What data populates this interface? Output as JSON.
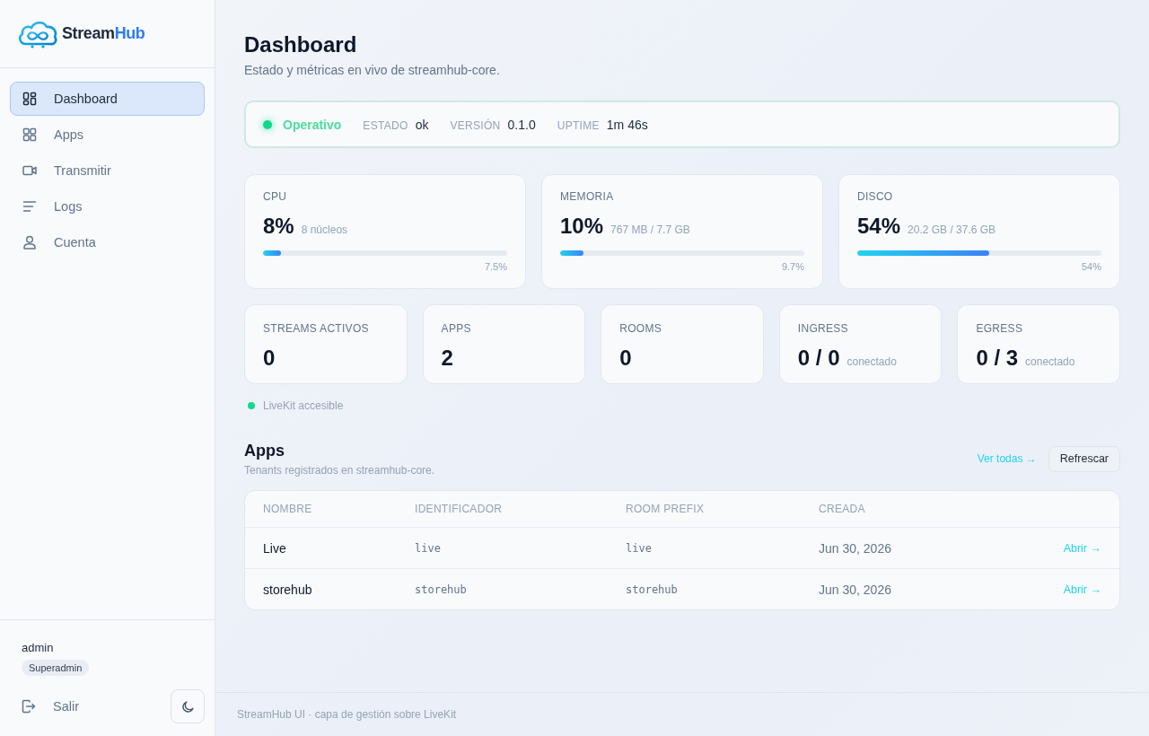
{
  "sidebar": {
    "brand": {
      "name": "Stream",
      "accent": "Hub"
    },
    "nav": [
      {
        "label": "Dashboard",
        "selected": true
      },
      {
        "label": "Apps",
        "selected": false
      },
      {
        "label": "Transmitir",
        "selected": false
      },
      {
        "label": "Logs",
        "selected": false
      },
      {
        "label": "Cuenta",
        "selected": false
      }
    ],
    "user": {
      "name": "admin",
      "role": "Superadmin"
    },
    "logout": "Salir"
  },
  "header": {
    "title": "Dashboard",
    "subtitle": "Estado y métricas en vivo de streamhub-core."
  },
  "status": {
    "state": "Operativo",
    "fields": [
      {
        "label": "ESTADO",
        "value": "ok"
      },
      {
        "label": "VERSIÓN",
        "value": "0.1.0"
      },
      {
        "label": "UPTIME",
        "value": "1m 46s"
      }
    ]
  },
  "resources": [
    {
      "label": "CPU",
      "value": "8%",
      "detail": "8 núcleos",
      "level": 0.075,
      "reading": "7.5%"
    },
    {
      "label": "MEMORIA",
      "value": "10%",
      "detail": "767 MB / 7.7 GB",
      "level": 0.097,
      "reading": "9.7%"
    },
    {
      "label": "DISCO",
      "value": "54%",
      "detail": "20.2 GB / 37.6 GB",
      "level": 0.54,
      "reading": "54%"
    }
  ],
  "counters": [
    {
      "label": "STREAMS ACTIVOS",
      "value": "0"
    },
    {
      "label": "APPS",
      "value": "2"
    },
    {
      "label": "ROOMS",
      "value": "0"
    },
    {
      "label": "INGRESS",
      "value": "0 / 0",
      "detail": "conectado"
    },
    {
      "label": "EGRESS",
      "value": "0 / 3",
      "detail": "conectado"
    }
  ],
  "livekit": "LiveKit accesible",
  "apps": {
    "title": "Apps",
    "subtitle": "Tenants registrados en streamhub-core.",
    "link": "Ver todas →",
    "button": "Refrescar",
    "table": {
      "columns": [
        "NOMBRE",
        "IDENTIFICADOR",
        "ROOM PREFIX",
        "CREADA"
      ],
      "rows": [
        {
          "name": "Live",
          "identifier": "live",
          "room_prefix": "live",
          "created": "Jun 30, 2026",
          "action": "Abrir →"
        },
        {
          "name": "storehub",
          "identifier": "storehub",
          "room_prefix": "storehub",
          "created": "Jun 30, 2026",
          "action": "Abrir →"
        }
      ]
    }
  },
  "footer": "StreamHub UI · capa de gestión sobre LiveKit"
}
